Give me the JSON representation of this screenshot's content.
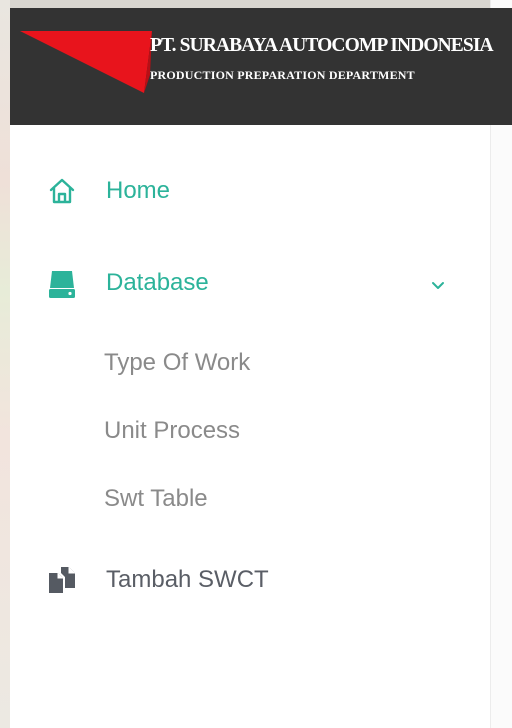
{
  "brand": {
    "company": "PT. SURABAYA AUTOCOMP INDONESIA",
    "department": "PRODUCTION PREPARATION DEPARTMENT",
    "logo_color": "#e8141c",
    "bar_color": "#333333"
  },
  "sidebar": {
    "items": [
      {
        "label": "Home",
        "icon": "home-icon",
        "color": "#2cb39a"
      },
      {
        "label": "Database",
        "icon": "hard-drive-icon",
        "color": "#2cb39a",
        "expanded": true,
        "children": [
          {
            "label": "Type Of Work"
          },
          {
            "label": "Unit Process"
          },
          {
            "label": "Swt Table"
          }
        ]
      },
      {
        "label": "Tambah SWCT",
        "icon": "copy-documents-icon",
        "color": "#5a5e66"
      }
    ]
  }
}
